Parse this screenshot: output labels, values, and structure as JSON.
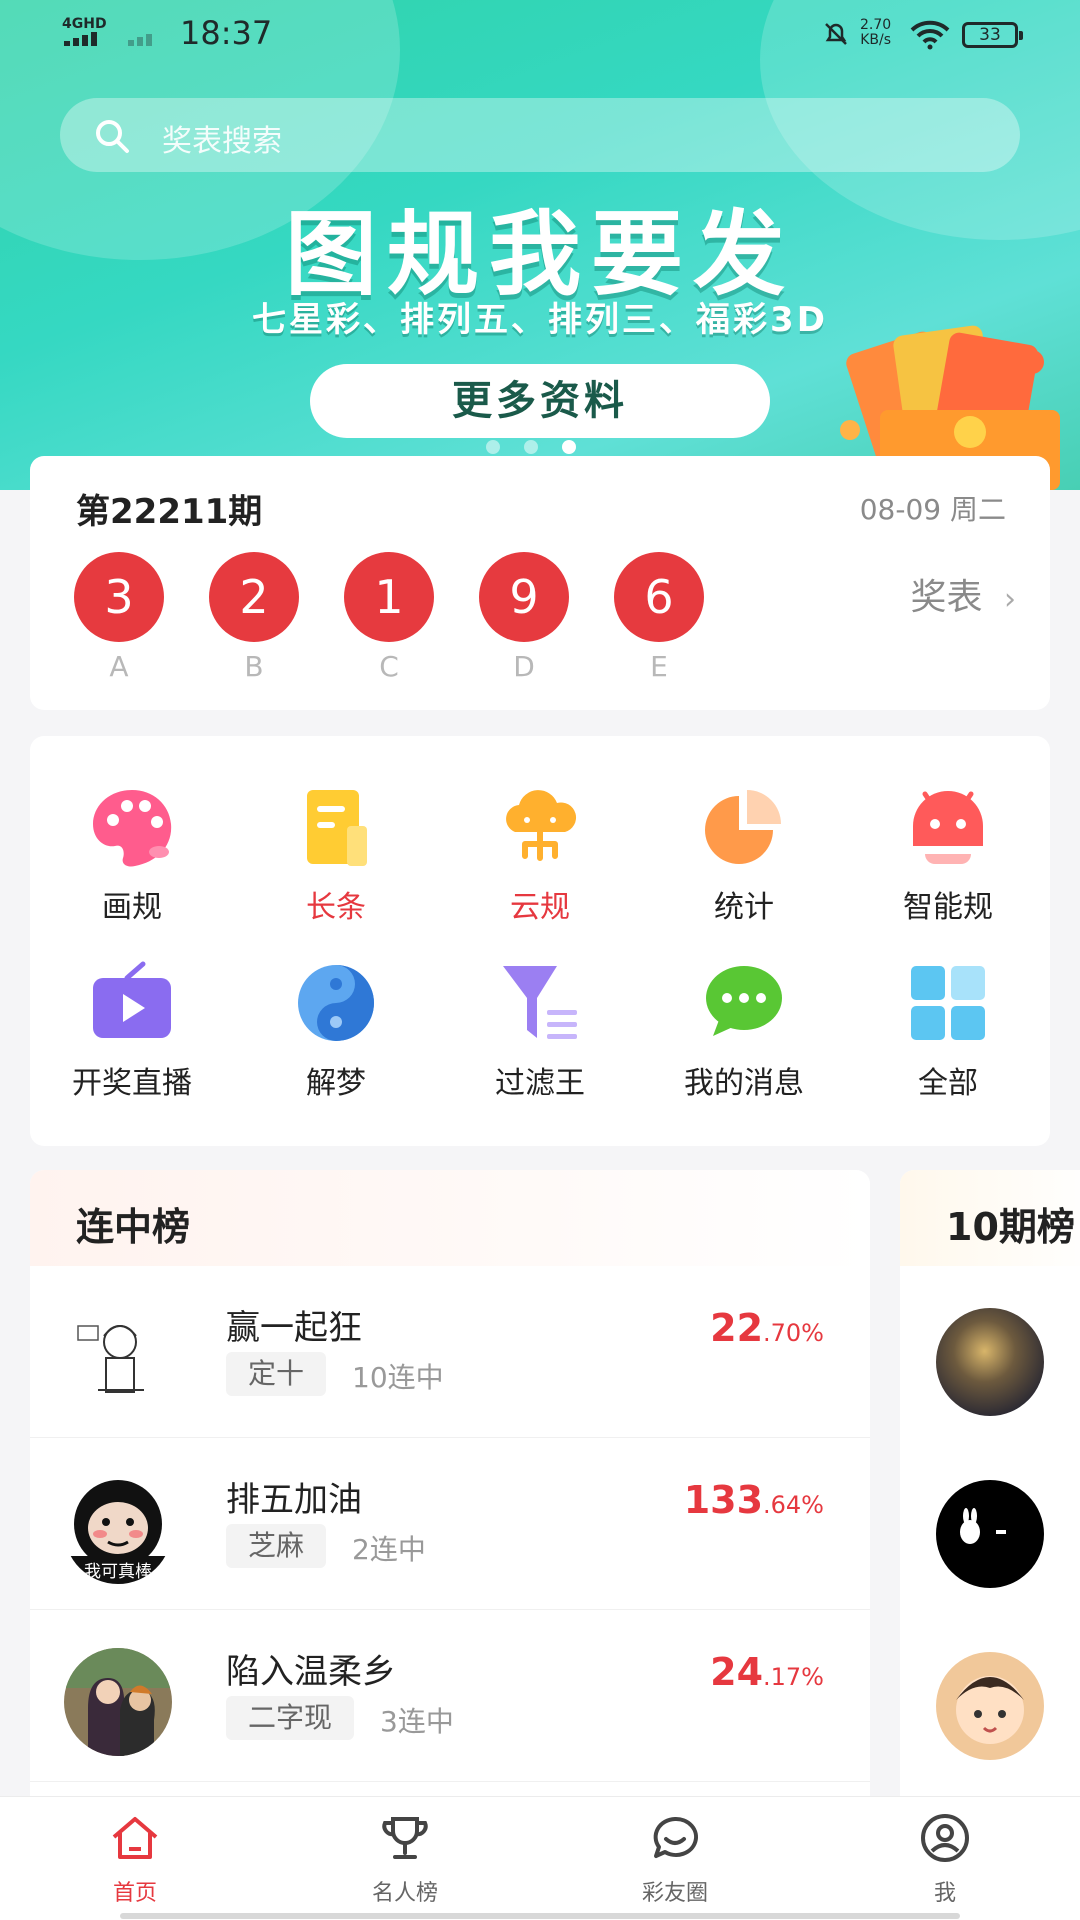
{
  "status_bar": {
    "network": "4GHD",
    "time": "18:37",
    "speed_value": "2.70",
    "speed_unit": "KB/s",
    "battery": "33"
  },
  "search": {
    "placeholder": "奖表搜索"
  },
  "banner": {
    "headline": "图规我要发",
    "subline": "七星彩、排列五、排列三、福彩3D",
    "button_label": "更多资料",
    "slide_count": 3,
    "active_slide": 3
  },
  "draw": {
    "issue": "第22211期",
    "date": "08-09 周二",
    "link_label": "奖表",
    "numbers": [
      {
        "value": "3",
        "label": "A"
      },
      {
        "value": "2",
        "label": "B"
      },
      {
        "value": "1",
        "label": "C"
      },
      {
        "value": "9",
        "label": "D"
      },
      {
        "value": "6",
        "label": "E"
      }
    ]
  },
  "functions": [
    {
      "label": "画规",
      "icon": "palette-icon",
      "highlight": false
    },
    {
      "label": "长条",
      "icon": "document-icon",
      "highlight": true
    },
    {
      "label": "云规",
      "icon": "cloud-icon",
      "highlight": true
    },
    {
      "label": "统计",
      "icon": "pie-chart-icon",
      "highlight": false
    },
    {
      "label": "智能规",
      "icon": "robot-icon",
      "highlight": false
    },
    {
      "label": "开奖直播",
      "icon": "tv-play-icon",
      "highlight": false
    },
    {
      "label": "解梦",
      "icon": "yin-yang-icon",
      "highlight": false
    },
    {
      "label": "过滤王",
      "icon": "filter-icon",
      "highlight": false
    },
    {
      "label": "我的消息",
      "icon": "chat-bubble-icon",
      "highlight": false
    },
    {
      "label": "全部",
      "icon": "grid-icon",
      "highlight": false
    }
  ],
  "ranking": {
    "title": "连中榜",
    "rows": [
      {
        "name": "赢一起狂",
        "tag": "定十",
        "streak": "10连中",
        "rate_int": "22",
        "rate_dec": ".70%"
      },
      {
        "name": "排五加油",
        "tag": "芝麻",
        "streak": "2连中",
        "rate_int": "133",
        "rate_dec": ".64%"
      },
      {
        "name": "陷入温柔乡",
        "tag": "二字现",
        "streak": "3连中",
        "rate_int": "24",
        "rate_dec": ".17%"
      }
    ]
  },
  "ranking2": {
    "title": "10期榜"
  },
  "avatar_texts": {
    "second": "我可真棒"
  },
  "nav": {
    "items": [
      {
        "label": "首页",
        "icon": "home-icon",
        "active": true
      },
      {
        "label": "名人榜",
        "icon": "trophy-icon",
        "active": false
      },
      {
        "label": "彩友圈",
        "icon": "chat-icon",
        "active": false
      },
      {
        "label": "我",
        "icon": "user-icon",
        "active": false
      }
    ]
  },
  "colors": {
    "accent": "#e6383f",
    "banner": "#35d8c2"
  }
}
